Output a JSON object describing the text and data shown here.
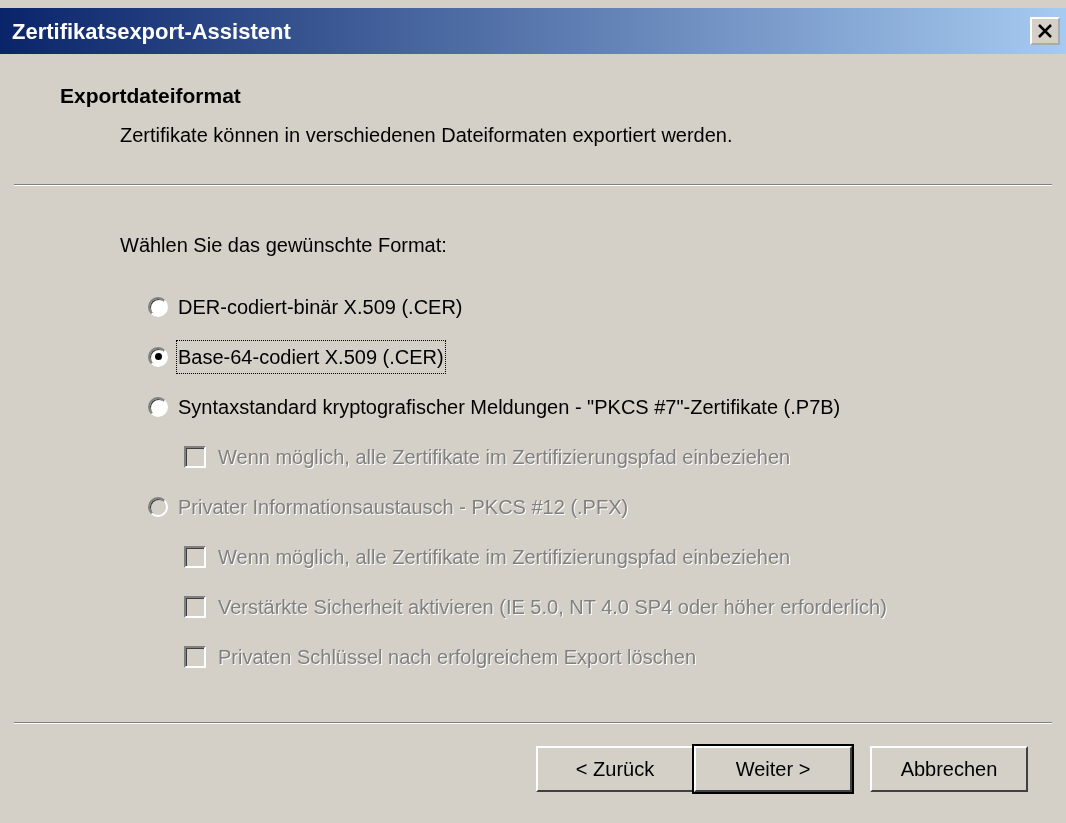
{
  "window": {
    "title": "Zertifikatsexport-Assistent"
  },
  "header": {
    "title": "Exportdateiformat",
    "subtitle": "Zertifikate können in verschiedenen Dateiformaten exportiert werden."
  },
  "prompt": "Wählen Sie das gewünschte Format:",
  "options": [
    {
      "label": "DER-codiert-binär X.509 (.CER)",
      "selected": false,
      "disabled": false
    },
    {
      "label": "Base-64-codiert X.509 (.CER)",
      "selected": true,
      "disabled": false
    },
    {
      "label": "Syntaxstandard kryptografischer Meldungen - \"PKCS #7\"-Zertifikate (.P7B)",
      "selected": false,
      "disabled": false,
      "children": [
        {
          "label": "Wenn möglich, alle Zertifikate im Zertifizierungspfad einbeziehen",
          "checked": false,
          "disabled": true
        }
      ]
    },
    {
      "label": "Privater Informationsaustausch - PKCS #12 (.PFX)",
      "selected": false,
      "disabled": true,
      "children": [
        {
          "label": "Wenn möglich, alle Zertifikate im Zertifizierungspfad einbeziehen",
          "checked": false,
          "disabled": true
        },
        {
          "label": "Verstärkte Sicherheit aktivieren (IE 5.0, NT 4.0 SP4 oder höher erforderlich)",
          "checked": false,
          "disabled": true
        },
        {
          "label": "Privaten Schlüssel nach erfolgreichem Export löschen",
          "checked": false,
          "disabled": true
        }
      ]
    }
  ],
  "buttons": [
    {
      "label": "< Zurück",
      "default": false
    },
    {
      "label": "Weiter >",
      "default": true
    },
    {
      "label": "Abbrechen",
      "default": false
    }
  ]
}
